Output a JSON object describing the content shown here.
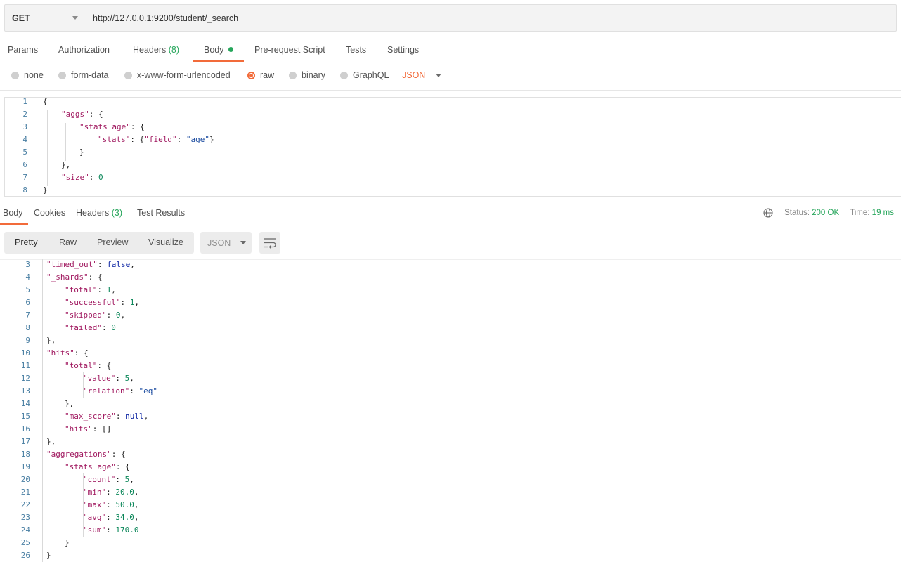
{
  "request": {
    "method": "GET",
    "url": "http://127.0.0.1:9200/student/_search"
  },
  "request_tabs": {
    "params": "Params",
    "authorization": "Authorization",
    "headers": "Headers",
    "headers_count": "(8)",
    "body": "Body",
    "prerequest": "Pre-request Script",
    "tests": "Tests",
    "settings": "Settings"
  },
  "body_types": {
    "none": "none",
    "form_data": "form-data",
    "urlencoded": "x-www-form-urlencoded",
    "raw": "raw",
    "binary": "binary",
    "graphql": "GraphQL",
    "language": "JSON"
  },
  "request_body": [
    {
      "n": "1",
      "parts": [
        [
          "p",
          "{"
        ]
      ]
    },
    {
      "n": "2",
      "parts": [
        [
          "k",
          "\"aggs\""
        ],
        [
          "p",
          ": {"
        ]
      ]
    },
    {
      "n": "3",
      "parts": [
        [
          "k",
          "\"stats_age\""
        ],
        [
          "p",
          ": {"
        ]
      ]
    },
    {
      "n": "4",
      "parts": [
        [
          "k",
          "\"stats\""
        ],
        [
          "p",
          ": {"
        ],
        [
          "k",
          "\"field\""
        ],
        [
          "p",
          ": "
        ],
        [
          "s",
          "\"age\""
        ],
        [
          "p",
          "}"
        ]
      ]
    },
    {
      "n": "5",
      "parts": [
        [
          "p",
          "}"
        ]
      ]
    },
    {
      "n": "6",
      "parts": [
        [
          "p",
          "},"
        ]
      ]
    },
    {
      "n": "7",
      "parts": [
        [
          "k",
          "\"size\""
        ],
        [
          "p",
          ": "
        ],
        [
          "n",
          "0"
        ]
      ]
    },
    {
      "n": "8",
      "parts": [
        [
          "p",
          "}"
        ]
      ]
    }
  ],
  "response_tabs": {
    "body": "Body",
    "cookies": "Cookies",
    "headers": "Headers",
    "headers_count": "(3)",
    "test_results": "Test Results"
  },
  "status": {
    "status_label": "Status:",
    "status_value": "200 OK",
    "time_label": "Time:",
    "time_value": "19 ms"
  },
  "response_view": {
    "pretty": "Pretty",
    "raw": "Raw",
    "preview": "Preview",
    "visualize": "Visualize",
    "format": "JSON"
  },
  "response_body": [
    {
      "n": "3",
      "parts": [
        [
          "k",
          "\"timed_out\""
        ],
        [
          "p",
          ": "
        ],
        [
          "b",
          "false"
        ],
        [
          "p",
          ","
        ]
      ]
    },
    {
      "n": "4",
      "parts": [
        [
          "k",
          "\"_shards\""
        ],
        [
          "p",
          ": {"
        ]
      ]
    },
    {
      "n": "5",
      "parts": [
        [
          "k",
          "\"total\""
        ],
        [
          "p",
          ": "
        ],
        [
          "n",
          "1"
        ],
        [
          "p",
          ","
        ]
      ]
    },
    {
      "n": "6",
      "parts": [
        [
          "k",
          "\"successful\""
        ],
        [
          "p",
          ": "
        ],
        [
          "n",
          "1"
        ],
        [
          "p",
          ","
        ]
      ]
    },
    {
      "n": "7",
      "parts": [
        [
          "k",
          "\"skipped\""
        ],
        [
          "p",
          ": "
        ],
        [
          "n",
          "0"
        ],
        [
          "p",
          ","
        ]
      ]
    },
    {
      "n": "8",
      "parts": [
        [
          "k",
          "\"failed\""
        ],
        [
          "p",
          ": "
        ],
        [
          "n",
          "0"
        ]
      ]
    },
    {
      "n": "9",
      "parts": [
        [
          "p",
          "},"
        ]
      ]
    },
    {
      "n": "10",
      "parts": [
        [
          "k",
          "\"hits\""
        ],
        [
          "p",
          ": {"
        ]
      ]
    },
    {
      "n": "11",
      "parts": [
        [
          "k",
          "\"total\""
        ],
        [
          "p",
          ": {"
        ]
      ]
    },
    {
      "n": "12",
      "parts": [
        [
          "k",
          "\"value\""
        ],
        [
          "p",
          ": "
        ],
        [
          "n",
          "5"
        ],
        [
          "p",
          ","
        ]
      ]
    },
    {
      "n": "13",
      "parts": [
        [
          "k",
          "\"relation\""
        ],
        [
          "p",
          ": "
        ],
        [
          "s",
          "\"eq\""
        ]
      ]
    },
    {
      "n": "14",
      "parts": [
        [
          "p",
          "},"
        ]
      ]
    },
    {
      "n": "15",
      "parts": [
        [
          "k",
          "\"max_score\""
        ],
        [
          "p",
          ": "
        ],
        [
          "b",
          "null"
        ],
        [
          "p",
          ","
        ]
      ]
    },
    {
      "n": "16",
      "parts": [
        [
          "k",
          "\"hits\""
        ],
        [
          "p",
          ": []"
        ]
      ]
    },
    {
      "n": "17",
      "parts": [
        [
          "p",
          "},"
        ]
      ]
    },
    {
      "n": "18",
      "parts": [
        [
          "k",
          "\"aggregations\""
        ],
        [
          "p",
          ": {"
        ]
      ]
    },
    {
      "n": "19",
      "parts": [
        [
          "k",
          "\"stats_age\""
        ],
        [
          "p",
          ": {"
        ]
      ]
    },
    {
      "n": "20",
      "parts": [
        [
          "k",
          "\"count\""
        ],
        [
          "p",
          ": "
        ],
        [
          "n",
          "5"
        ],
        [
          "p",
          ","
        ]
      ]
    },
    {
      "n": "21",
      "parts": [
        [
          "k",
          "\"min\""
        ],
        [
          "p",
          ": "
        ],
        [
          "n",
          "20.0"
        ],
        [
          "p",
          ","
        ]
      ]
    },
    {
      "n": "22",
      "parts": [
        [
          "k",
          "\"max\""
        ],
        [
          "p",
          ": "
        ],
        [
          "n",
          "50.0"
        ],
        [
          "p",
          ","
        ]
      ]
    },
    {
      "n": "23",
      "parts": [
        [
          "k",
          "\"avg\""
        ],
        [
          "p",
          ": "
        ],
        [
          "n",
          "34.0"
        ],
        [
          "p",
          ","
        ]
      ]
    },
    {
      "n": "24",
      "parts": [
        [
          "k",
          "\"sum\""
        ],
        [
          "p",
          ": "
        ],
        [
          "n",
          "170.0"
        ]
      ]
    },
    {
      "n": "25",
      "parts": [
        [
          "p",
          "}"
        ]
      ]
    },
    {
      "n": "26",
      "parts": [
        [
          "p",
          "}"
        ]
      ]
    }
  ]
}
